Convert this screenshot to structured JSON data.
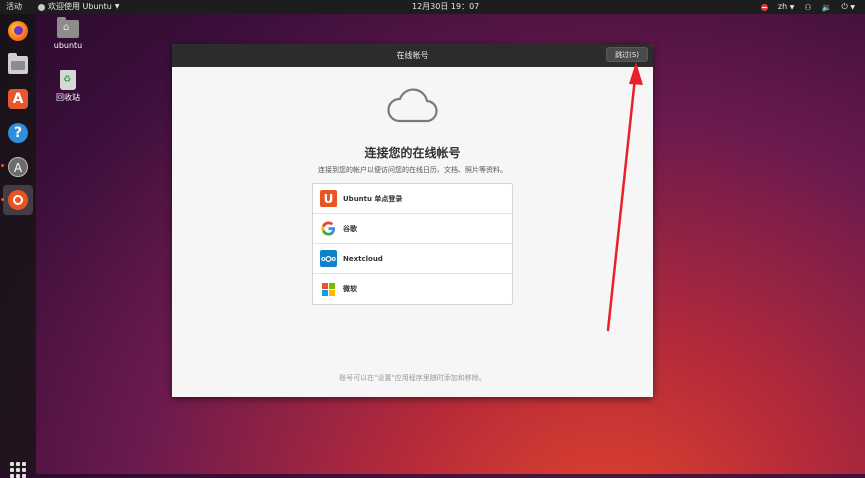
{
  "topbar": {
    "activities": "活动",
    "app_name": "欢迎使用 Ubuntu",
    "clock": "12月30日  19：07",
    "lang": "zh"
  },
  "desktop": {
    "home_label": "ubuntu",
    "trash_label": "回收站"
  },
  "dialog": {
    "title": "在线帐号",
    "skip_label": "跳过(S)",
    "heading": "连接您的在线帐号",
    "subtitle": "连接到您的帐户以便访问您的在线日历、文档、照片等资料。",
    "providers": [
      {
        "name": "Ubuntu 单点登录",
        "icon": "ubuntu-sso-icon"
      },
      {
        "name": "谷歌",
        "icon": "google-icon"
      },
      {
        "name": "Nextcloud",
        "icon": "nextcloud-icon"
      },
      {
        "name": "微软",
        "icon": "microsoft-icon"
      }
    ],
    "footer": "账号可以在\"设置\"应用程序里随时添加和移除。"
  },
  "colors": {
    "ubuntu_orange": "#e95420",
    "annotation_red": "#e8202a",
    "titlebar": "#2c2c2c"
  }
}
